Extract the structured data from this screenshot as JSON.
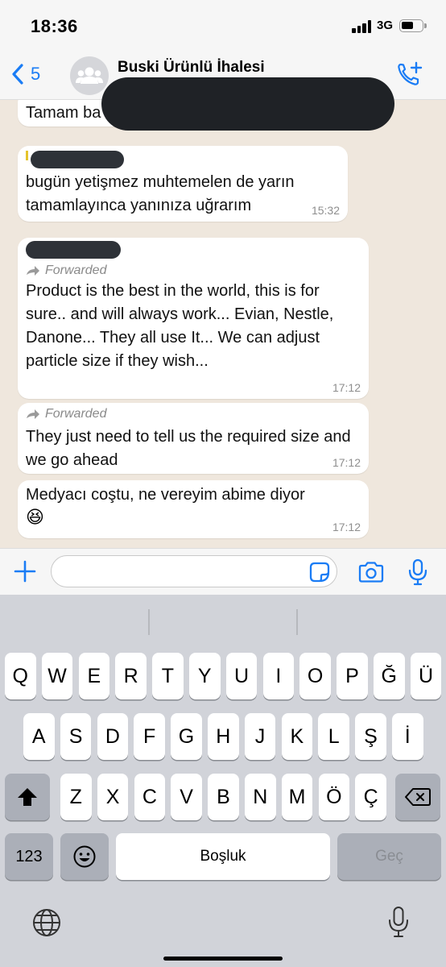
{
  "status_bar": {
    "time": "18:36",
    "network": "3G"
  },
  "header": {
    "back_count": "5",
    "title": "Buski Ürünlü İhalesi"
  },
  "messages": [
    {
      "text": "Tamam ba"
    },
    {
      "text": "bugün yetişmez muhtemelen de yarın tamamlayınca yanınıza uğrarım",
      "time": "15:32"
    },
    {
      "forwarded_label": "Forwarded",
      "text": "Product is the best in the world, this is for sure.. and will always work... Evian, Nestle, Danone... They all use It...   We can adjust particle size if they wish...",
      "time": "17:12"
    },
    {
      "forwarded_label": "Forwarded",
      "text": "They just need to tell us the required size and we go ahead",
      "time": "17:12"
    },
    {
      "text": "Medyacı coştu, ne vereyim abime diyor",
      "emoji": "😆",
      "time": "17:12"
    }
  ],
  "input": {
    "placeholder": ""
  },
  "keyboard": {
    "row1": [
      "Q",
      "W",
      "E",
      "R",
      "T",
      "Y",
      "U",
      "I",
      "O",
      "P",
      "Ğ",
      "Ü"
    ],
    "row2": [
      "A",
      "S",
      "D",
      "F",
      "G",
      "H",
      "J",
      "K",
      "L",
      "Ş",
      "İ"
    ],
    "row3": [
      "Z",
      "X",
      "C",
      "V",
      "B",
      "N",
      "M",
      "Ö",
      "Ç"
    ],
    "numbers_key": "123",
    "space_key": "Boşluk",
    "return_key": "Geç"
  },
  "icons": {
    "back": "chevron-left-icon",
    "avatar": "group-icon",
    "call_add": "phone-plus-icon",
    "forward": "forward-arrow-icon",
    "attach": "plus-icon",
    "sticker": "sticker-icon",
    "camera": "camera-icon",
    "mic": "microphone-icon",
    "shift": "shift-icon",
    "delete": "backspace-icon",
    "emoji": "emoji-icon",
    "globe": "globe-icon"
  },
  "colors": {
    "accent": "#1a7cf5",
    "chat_bg": "#efe7dd",
    "bubble": "#ffffff",
    "keyboard_bg": "#d1d3d9",
    "key_dark": "#abafb8"
  }
}
